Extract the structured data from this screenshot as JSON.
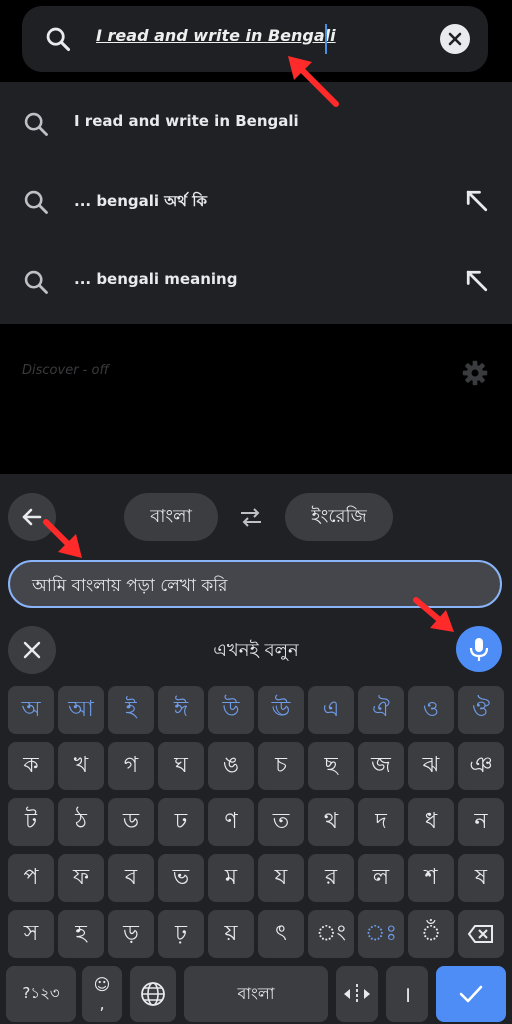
{
  "search": {
    "query": "I read and write in Bengali"
  },
  "suggestions": [
    {
      "text": "I read and write in Bengali",
      "has_fill": false
    },
    {
      "text": "... bengali অর্থ কি",
      "has_fill": true
    },
    {
      "text": "... bengali meaning",
      "has_fill": true
    }
  ],
  "discover": {
    "label": "Discover - off"
  },
  "translator": {
    "source_lang": "বাংলা",
    "target_lang": "ইংরেজি",
    "input_text": "আমি বাংলায় পড়া লেখা করি",
    "speak_prompt": "এখনই বলুন"
  },
  "keyboard": {
    "rows": [
      [
        "অ",
        "আ",
        "ই",
        "ঈ",
        "উ",
        "ঊ",
        "এ",
        "ঐ",
        "ও",
        "ঔ"
      ],
      [
        "ক",
        "খ",
        "গ",
        "ঘ",
        "ঙ",
        "চ",
        "ছ",
        "জ",
        "ঝ",
        "ঞ"
      ],
      [
        "ট",
        "ঠ",
        "ড",
        "ঢ",
        "ণ",
        "ত",
        "থ",
        "দ",
        "ধ",
        "ন"
      ],
      [
        "প",
        "ফ",
        "ব",
        "ভ",
        "ম",
        "য",
        "র",
        "ল",
        "শ",
        "ষ"
      ],
      [
        "স",
        "হ",
        "ড়",
        "ঢ়",
        "য়",
        "ৎ",
        "ং",
        "ঃ",
        "ঁ"
      ]
    ],
    "symbols_label": "?১২৩",
    "emoji_label": "☺",
    "comma_label": ",",
    "space_label": "বাংলা",
    "period_label": "।"
  },
  "colors": {
    "accent": "#4d8df5",
    "panel": "#202124",
    "key": "#3c3d40",
    "vowel": "#6e9ae6",
    "annotation": "#ff2a2a"
  }
}
